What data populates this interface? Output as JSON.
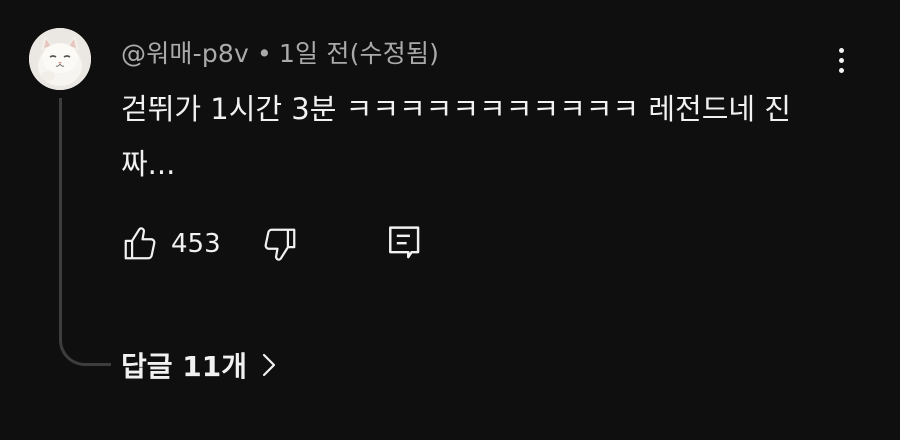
{
  "comment": {
    "author": "@워매-p8v",
    "separator": "•",
    "timestamp": "1일 전(수정됨)",
    "text": "걷뛰가 1시간 3분 ㅋㅋㅋㅋㅋㅋㅋㅋㅋㅋㅋ 레전드네 진짜...",
    "like_count": "453"
  },
  "replies": {
    "label": "답글 11개"
  },
  "icons": {
    "avatar": "cat-avatar",
    "like": "thumbs-up-icon",
    "dislike": "thumbs-down-icon",
    "reply": "reply-comment-icon",
    "more": "more-vertical-icon",
    "chevron": "chevron-right-icon"
  },
  "colors": {
    "background": "#0f0f0f",
    "text": "#f1f1f1",
    "meta_text": "#aaaaaa",
    "thread_line": "#3d3d3d"
  }
}
